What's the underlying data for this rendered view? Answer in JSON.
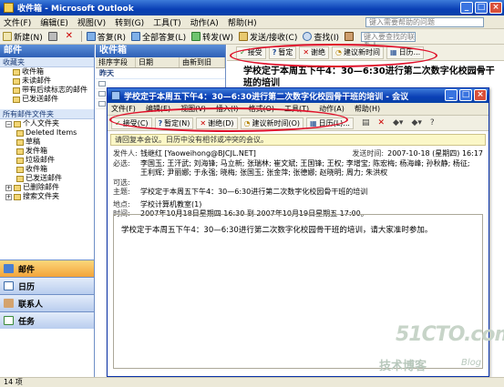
{
  "window": {
    "title": "收件箱 - Microsoft Outlook"
  },
  "menu": [
    "文件(F)",
    "编辑(E)",
    "视图(V)",
    "转到(G)",
    "工具(T)",
    "动作(A)",
    "帮助(H)"
  ],
  "help_placeholder": "键入需要帮助的问题",
  "toolbar": {
    "new": "新建(N)",
    "reply": "答复(R)",
    "reply_all": "全部答复(L)",
    "forward": "转发(W)",
    "send_receive": "发送/接收(C)",
    "find": "查找(I)",
    "contact_placeholder": "键入要查找的联系人"
  },
  "nav": {
    "header": "邮件",
    "favorites_title": "收藏夹",
    "favorites": [
      "收件箱",
      "未读邮件",
      "带有后续标志的邮件",
      "已发送邮件"
    ],
    "all_title": "所有邮件文件夹",
    "tree": [
      "个人文件夹",
      "Deleted Items",
      "草稿",
      "发件箱",
      "垃圾邮件",
      "收件箱",
      "已发送邮件",
      "已删除邮件",
      "搜索文件夹"
    ],
    "buttons": [
      "邮件",
      "日历",
      "联系人",
      "任务"
    ]
  },
  "status": "14 项",
  "list": {
    "header": "收件箱",
    "col_arrange": "排序字段",
    "col_date": "日期",
    "col_order": "由新到旧",
    "group": "昨天"
  },
  "reading": {
    "buttons": [
      "接受",
      "暂定",
      "谢绝",
      "建议新时间",
      "日历..."
    ],
    "subject": "学校定于本周五下午4：30—6:30进行第二次数字化校园骨干班的培训"
  },
  "meeting": {
    "title": "学校定于本周五下午4：30—6:30进行第二次数字化校园骨干班的培训 - 会议",
    "menu": [
      "文件(F)",
      "编辑(E)",
      "视图(V)",
      "插入(I)",
      "格式(O)",
      "工具(T)",
      "动作(A)",
      "帮助(H)"
    ],
    "buttons": [
      "接受(C)",
      "暂定(N)",
      "谢绝(D)",
      "建议新时间(O)",
      "日历(L)..."
    ],
    "infobar": "请回复本会议。日历中没有相邻或冲突的会议。",
    "labels": {
      "from": "发件人:",
      "sent": "发送时间:",
      "required": "必选:",
      "optional": "可选:",
      "subject": "主题:",
      "location": "地点:",
      "time": "时间:"
    },
    "from": "钱继红 [Yaoweihong@BJCJL.NET]",
    "sent": "2007-10-18 (星期四) 16:17",
    "required_line1": "李国玉; 王汗武; 刘海锋; 马立新; 张瑞林; 崔文斌; 王国锋; 王权; 李增宝; 陈宏梅; 杨海峰; 孙秋静; 杨征;",
    "required_line2": "王利辉; 尹丽娜; 于永强; 晓梅; 张国玉; 张金萍; 张德娜; 赵晓明; 周力; 朱洪权",
    "optional": "",
    "subject": "学校定于本周五下午4：30—6:30进行第二次数字化校园骨干班的培训",
    "location": "学校计算机教室(1)",
    "time": "2007年10月18日星期四 16:30 到 2007年10月19日星期五 17:00。",
    "body": "学校定于本周五下午4：30—6:30进行第二次数字化校园骨干班的培训，请大家准时参加。"
  },
  "watermark": {
    "line1": "51CTO.com",
    "line2": "技术博客",
    "line3": "Blog"
  }
}
